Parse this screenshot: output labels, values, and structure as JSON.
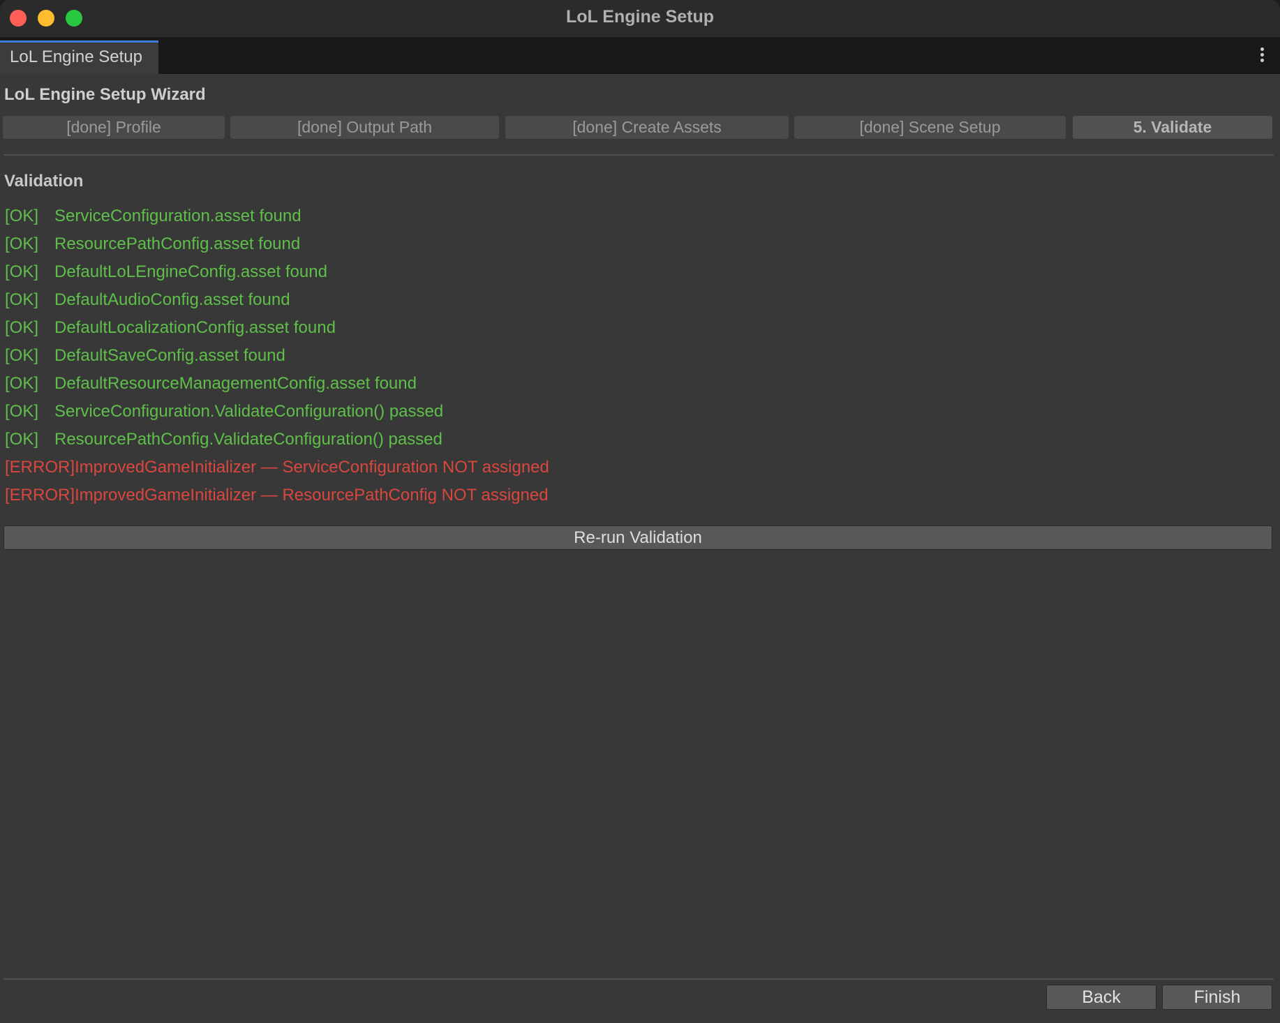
{
  "window": {
    "title": "LoL Engine Setup"
  },
  "tab": {
    "label": "LoL Engine Setup"
  },
  "wizard": {
    "title": "LoL Engine Setup Wizard",
    "steps": [
      {
        "label": "[done] Profile",
        "active": false
      },
      {
        "label": "[done] Output Path",
        "active": false
      },
      {
        "label": "[done] Create Assets",
        "active": false
      },
      {
        "label": "[done] Scene Setup",
        "active": false
      },
      {
        "label": "5. Validate",
        "active": true
      }
    ]
  },
  "validation": {
    "title": "Validation",
    "results": [
      {
        "status": "ok",
        "tag": "[OK]",
        "message": "ServiceConfiguration.asset found"
      },
      {
        "status": "ok",
        "tag": "[OK]",
        "message": "ResourcePathConfig.asset found"
      },
      {
        "status": "ok",
        "tag": "[OK]",
        "message": "DefaultLoLEngineConfig.asset found"
      },
      {
        "status": "ok",
        "tag": "[OK]",
        "message": "DefaultAudioConfig.asset found"
      },
      {
        "status": "ok",
        "tag": "[OK]",
        "message": "DefaultLocalizationConfig.asset found"
      },
      {
        "status": "ok",
        "tag": "[OK]",
        "message": "DefaultSaveConfig.asset found"
      },
      {
        "status": "ok",
        "tag": "[OK]",
        "message": "DefaultResourceManagementConfig.asset found"
      },
      {
        "status": "ok",
        "tag": "[OK]",
        "message": "ServiceConfiguration.ValidateConfiguration() passed"
      },
      {
        "status": "ok",
        "tag": "[OK]",
        "message": "ResourcePathConfig.ValidateConfiguration() passed"
      },
      {
        "status": "error",
        "tag": "[ERROR]",
        "message": "ImprovedGameInitializer — ServiceConfiguration NOT assigned"
      },
      {
        "status": "error",
        "tag": "[ERROR]",
        "message": "ImprovedGameInitializer — ResourcePathConfig NOT assigned"
      }
    ],
    "rerun_label": "Re-run Validation"
  },
  "footer": {
    "back_label": "Back",
    "finish_label": "Finish"
  },
  "colors": {
    "ok": "#5fbf4a",
    "error": "#d9473e",
    "tab_accent": "#3d7bd9"
  }
}
